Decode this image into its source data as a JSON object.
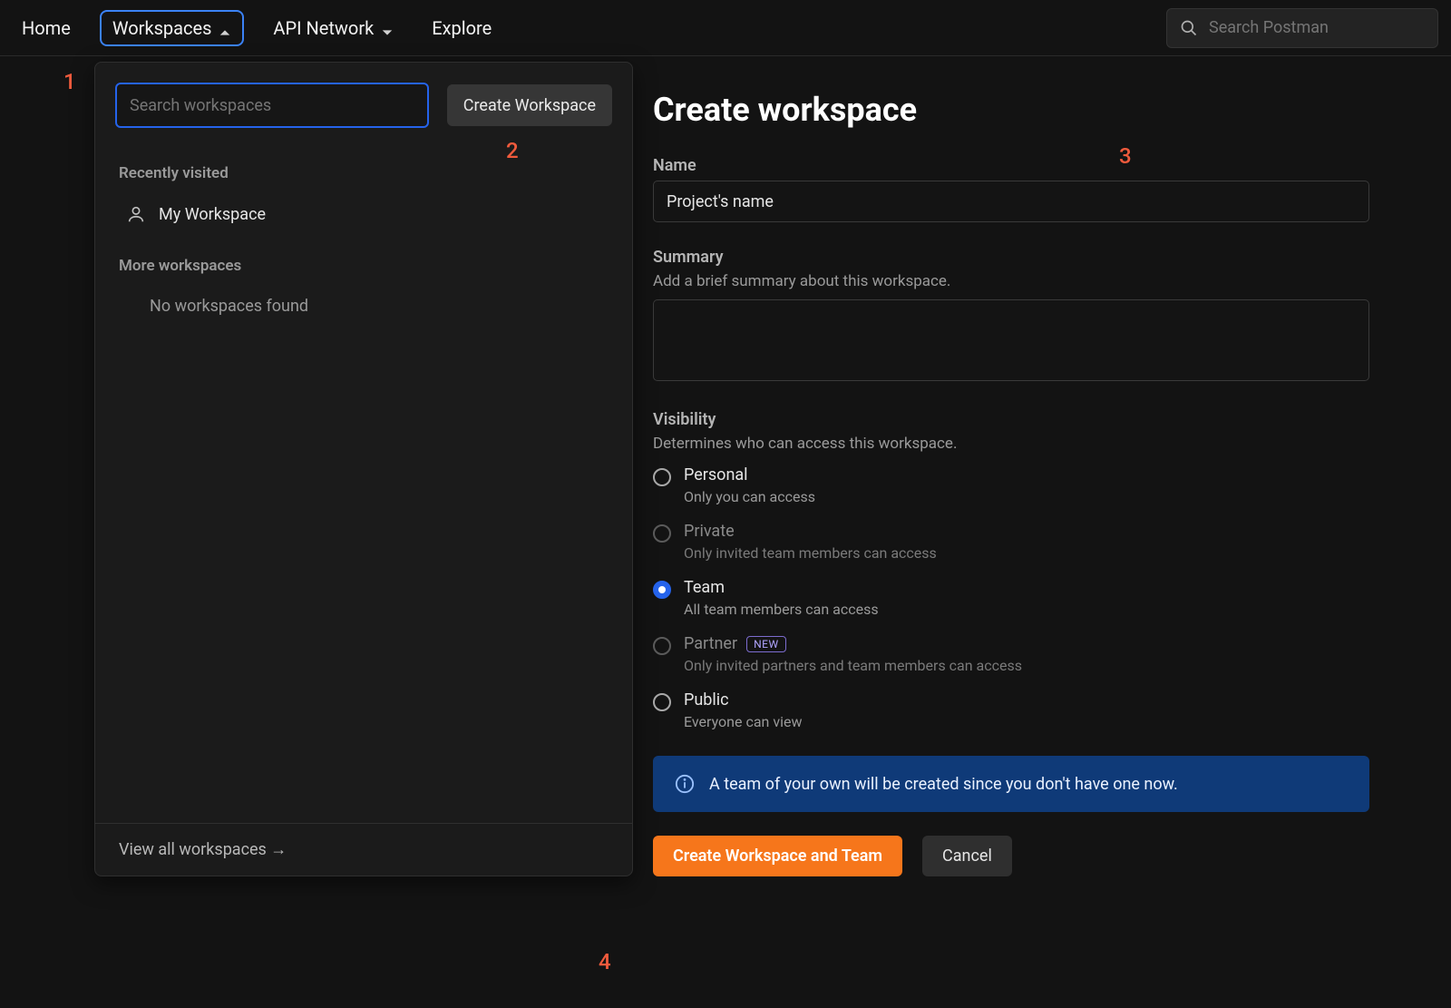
{
  "nav": {
    "home": "Home",
    "workspaces": "Workspaces",
    "api_network": "API Network",
    "explore": "Explore",
    "search_placeholder": "Search Postman"
  },
  "dropdown": {
    "search_placeholder": "Search workspaces",
    "create_btn": "Create Workspace",
    "recently_heading": "Recently visited",
    "recent_items": [
      "My Workspace"
    ],
    "more_heading": "More workspaces",
    "none_found": "No workspaces found",
    "view_all": "View all workspaces →"
  },
  "form": {
    "title": "Create workspace",
    "name_label": "Name",
    "name_value": "Project's name",
    "summary_label": "Summary",
    "summary_sub": "Add a brief summary about this workspace.",
    "visibility_label": "Visibility",
    "visibility_sub": "Determines who can access this workspace.",
    "options": [
      {
        "label": "Personal",
        "desc": "Only you can access",
        "state": "enabled"
      },
      {
        "label": "Private",
        "desc": "Only invited team members can access",
        "state": "disabled"
      },
      {
        "label": "Team",
        "desc": "All team members can access",
        "state": "selected"
      },
      {
        "label": "Partner",
        "desc": "Only invited partners and team members can access",
        "state": "disabled",
        "badge": "NEW"
      },
      {
        "label": "Public",
        "desc": "Everyone can view",
        "state": "enabled"
      }
    ],
    "info": "A team of your own will be created since you don't have one now.",
    "primary_btn": "Create Workspace and Team",
    "cancel_btn": "Cancel"
  },
  "annotations": {
    "a1": "1",
    "a2": "2",
    "a3": "3",
    "a4": "4"
  },
  "colors": {
    "accent_blue": "#2563eb",
    "primary_orange": "#f6761b",
    "banner_blue": "#0f3a78"
  }
}
